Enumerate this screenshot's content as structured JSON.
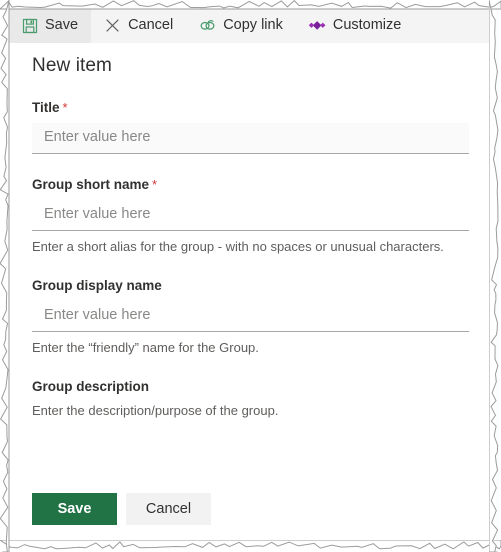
{
  "command_bar": {
    "items": [
      {
        "label": "Save",
        "icon": "save-floppy-icon",
        "active": true
      },
      {
        "label": "Cancel",
        "icon": "close-x-icon",
        "active": false
      },
      {
        "label": "Copy link",
        "icon": "chain-link-icon",
        "active": false
      },
      {
        "label": "Customize",
        "icon": "customize-diamonds-icon",
        "active": false
      }
    ]
  },
  "form": {
    "title": "New item",
    "fields": [
      {
        "label": "Title",
        "required": true,
        "required_marker": "*",
        "placeholder": "Enter value here",
        "value": "",
        "description": "",
        "has_input": true,
        "hover": true
      },
      {
        "label": "Group short name",
        "required": true,
        "required_marker": "*",
        "placeholder": "Enter value here",
        "value": "",
        "description": "Enter a short alias for the group - with no spaces or unusual characters.",
        "has_input": true,
        "hover": false
      },
      {
        "label": "Group display name",
        "required": false,
        "required_marker": "",
        "placeholder": "Enter value here",
        "value": "",
        "description": "Enter the “friendly” name for the Group.",
        "has_input": true,
        "hover": false
      },
      {
        "label": "Group description",
        "required": false,
        "required_marker": "",
        "placeholder": "",
        "value": "",
        "description": "Enter the description/purpose of the group.",
        "has_input": false,
        "hover": false
      }
    ],
    "actions": {
      "save_label": "Save",
      "cancel_label": "Cancel"
    }
  },
  "colors": {
    "save_green": "#217346",
    "icon_green": "#4a9c6d",
    "customize_purple": "#8a2be2",
    "required_red": "#d13438",
    "command_bar_bg": "#f4f4f4",
    "cancel_gray": "#f2f2f2"
  }
}
